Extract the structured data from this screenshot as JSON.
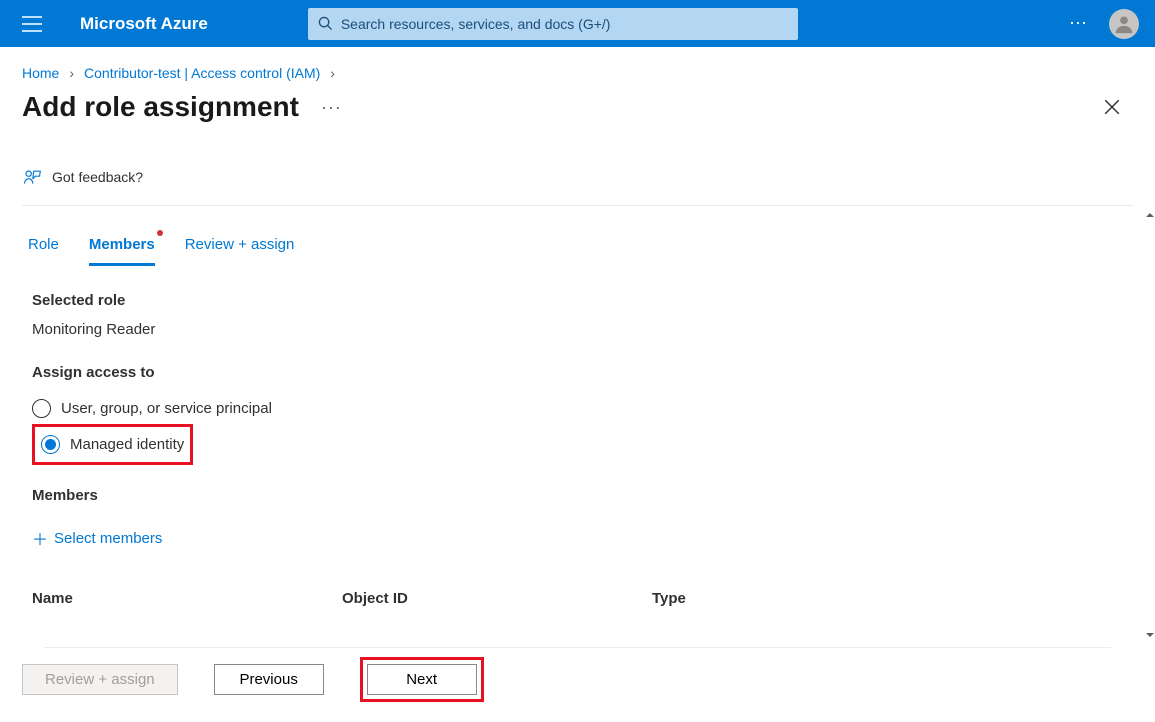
{
  "topbar": {
    "brand": "Microsoft Azure",
    "search_placeholder": "Search resources, services, and docs (G+/)"
  },
  "breadcrumb": {
    "items": [
      "Home",
      "Contributor-test | Access control (IAM)"
    ]
  },
  "page": {
    "title": "Add role assignment",
    "feedback_label": "Got feedback?"
  },
  "tabs": {
    "items": [
      {
        "label": "Role",
        "active": false,
        "dot": false
      },
      {
        "label": "Members",
        "active": true,
        "dot": true
      },
      {
        "label": "Review + assign",
        "active": false,
        "dot": false
      }
    ]
  },
  "body": {
    "selected_role_label": "Selected role",
    "selected_role_value": "Monitoring Reader",
    "assign_label": "Assign access to",
    "radio_user": "User, group, or service principal",
    "radio_mi": "Managed identity",
    "members_label": "Members",
    "select_members": "Select members",
    "columns": {
      "name": "Name",
      "oid": "Object ID",
      "type": "Type"
    }
  },
  "footer": {
    "review": "Review + assign",
    "previous": "Previous",
    "next": "Next"
  }
}
